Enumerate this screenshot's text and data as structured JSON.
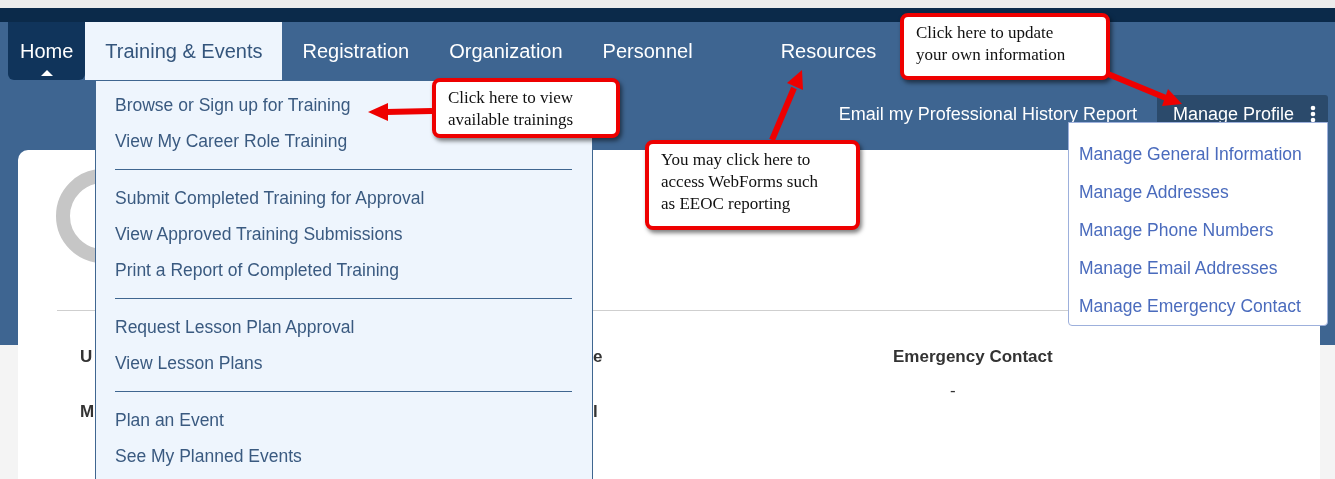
{
  "nav": {
    "tabs": [
      {
        "label": "Home",
        "selected": true,
        "expanded": false
      },
      {
        "label": "Training & Events",
        "selected": false,
        "expanded": true
      },
      {
        "label": "Registration",
        "selected": false,
        "expanded": false
      },
      {
        "label": "Organization",
        "selected": false,
        "expanded": false
      },
      {
        "label": "Personnel",
        "selected": false,
        "expanded": false
      },
      {
        "label": "Resources",
        "selected": false,
        "expanded": false
      }
    ]
  },
  "header": {
    "report_link": "Email my Professional History Report",
    "profile_button": "Manage Profile"
  },
  "profile": {
    "rows": [
      {
        "cells": [
          {
            "label": "U"
          },
          {
            "label": "e"
          },
          {
            "label": "Emergency Contact",
            "value": "-"
          }
        ]
      },
      {
        "cells": [
          {
            "label": "M"
          },
          {
            "label": "l"
          }
        ]
      }
    ]
  },
  "training_menu": {
    "groups": [
      {
        "items": [
          "Browse or Sign up for Training",
          "View My Career Role Training"
        ]
      },
      {
        "items": [
          "Submit Completed Training for Approval",
          "View Approved Training Submissions",
          "Print a Report of Completed Training"
        ]
      },
      {
        "items": [
          "Request Lesson Plan Approval",
          "View Lesson Plans"
        ]
      },
      {
        "items": [
          "Plan an Event",
          "See My Planned Events"
        ]
      }
    ]
  },
  "profile_menu": {
    "items": [
      "Manage General Information",
      "Manage Addresses",
      "Manage Phone Numbers",
      "Manage Email Addresses",
      "Manage Emergency Contact"
    ]
  },
  "callouts": [
    {
      "text": "Click here to view\navailable trainings"
    },
    {
      "text": "You may click here to\naccess WebForms such\nas EEOC reporting"
    },
    {
      "text": "Click here to update\nyour own information"
    }
  ]
}
